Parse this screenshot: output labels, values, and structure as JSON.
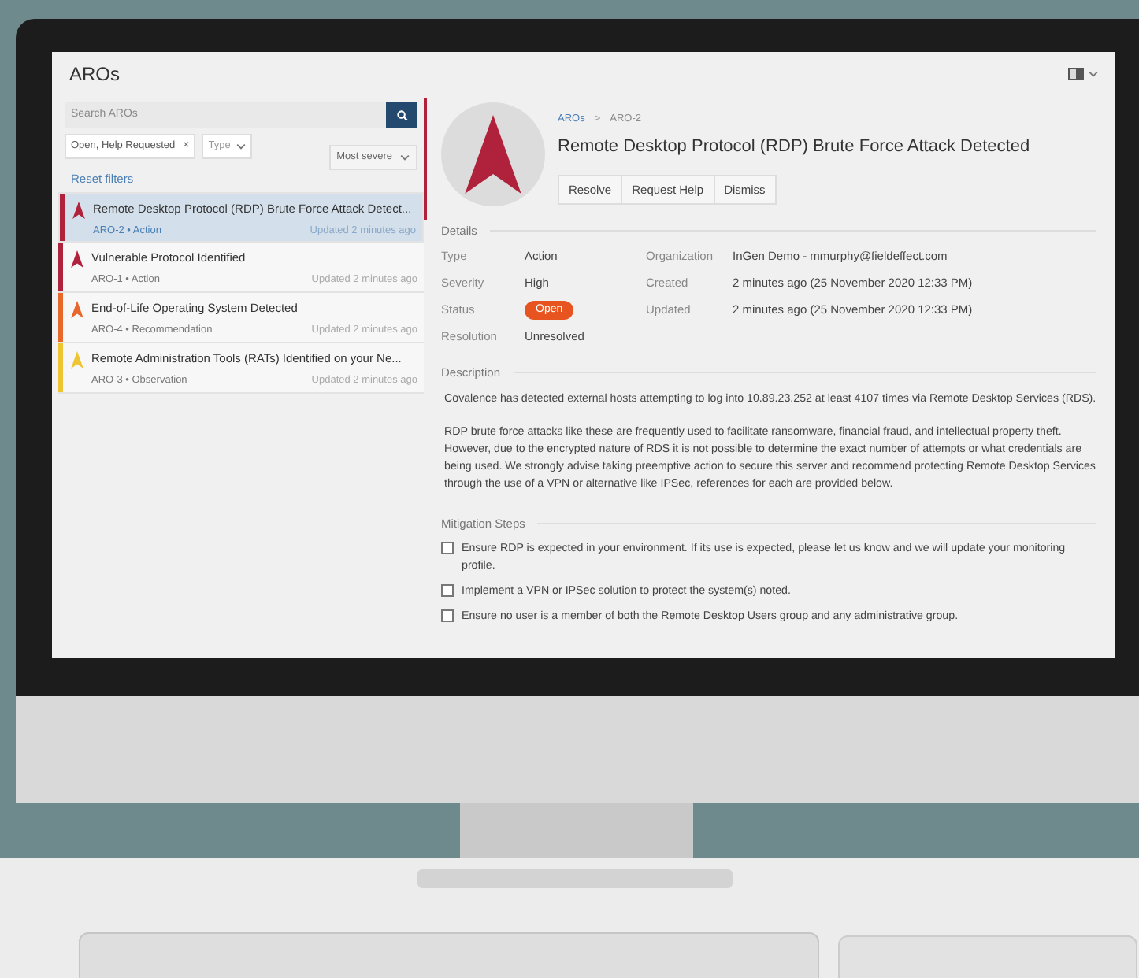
{
  "window": {
    "title": "AROs"
  },
  "search": {
    "placeholder": "Search AROs"
  },
  "filters": [
    {
      "kind": "chip",
      "label": "Open, Help Requested",
      "remove": "×"
    },
    {
      "kind": "dropdown",
      "label": "Type"
    }
  ],
  "sort": {
    "label": "Most severe"
  },
  "reset_filters": "Reset filters",
  "aro_list": [
    {
      "title": "Remote Desktop Protocol (RDP) Brute Force Attack Detect...",
      "meta": "ARO-2 • Action",
      "updated": "Updated 2 minutes ago",
      "color": "#b0213c",
      "selected": true
    },
    {
      "title": "Vulnerable Protocol Identified",
      "meta": "ARO-1 • Action",
      "updated": "Updated 2 minutes ago",
      "color": "#b0213c",
      "selected": false
    },
    {
      "title": "End-of-Life Operating System Detected",
      "meta": "ARO-4 • Recommendation",
      "updated": "Updated 2 minutes ago",
      "color": "#e8682c",
      "selected": false
    },
    {
      "title": "Remote Administration Tools (RATs) Identified on your Ne...",
      "meta": "ARO-3 • Observation",
      "updated": "Updated 2 minutes ago",
      "color": "#efc433",
      "selected": false
    }
  ],
  "detail": {
    "breadcrumb": [
      "AROs",
      "ARO-2"
    ],
    "separator": ">",
    "title": "Remote Desktop Protocol (RDP) Brute Force Attack Detected",
    "actions": [
      "Resolve",
      "Request Help",
      "Dismiss"
    ],
    "details_heading": "Details",
    "fields_left": [
      {
        "kind": "text",
        "label": "Type",
        "value": "Action"
      },
      {
        "kind": "text",
        "label": "Severity",
        "value": "High"
      },
      {
        "kind": "badge",
        "label": "Status",
        "value": "Open"
      },
      {
        "kind": "text",
        "label": "Resolution",
        "value": "Unresolved"
      }
    ],
    "fields_right": [
      {
        "label": "Organization",
        "value": "InGen Demo - mmurphy@fieldeffect.com"
      },
      {
        "label": "Created",
        "value": "2 minutes ago (25 November 2020 12:33 PM)"
      },
      {
        "label": "Updated",
        "value": "2 minutes ago (25 November 2020 12:33 PM)"
      }
    ],
    "description_heading": "Description",
    "description": [
      "Covalence has detected external hosts attempting to log into 10.89.23.252 at least 4107 times via Remote Desktop Services (RDS).",
      "RDP brute force attacks like these are frequently used to facilitate ransomware, financial fraud, and intellectual property theft. However, due to the encrypted nature of RDS it is not possible to determine the exact number of attempts or what credentials are being used. We strongly advise taking preemptive action to secure this server and recommend protecting Remote Desktop Services through the use of a VPN or alternative like IPSec, references for each are provided below."
    ],
    "mitigation_heading": "Mitigation Steps",
    "steps": [
      {
        "text": "Ensure RDP is expected in your environment. If its use is expected, please let us know and we will update your monitoring profile.",
        "checked": false
      },
      {
        "text": "Implement a VPN or IPSec solution to protect the system(s) noted.",
        "checked": false
      },
      {
        "text": "Ensure no user is a member of both the Remote Desktop Users group and any administrative group.",
        "checked": false
      }
    ]
  }
}
